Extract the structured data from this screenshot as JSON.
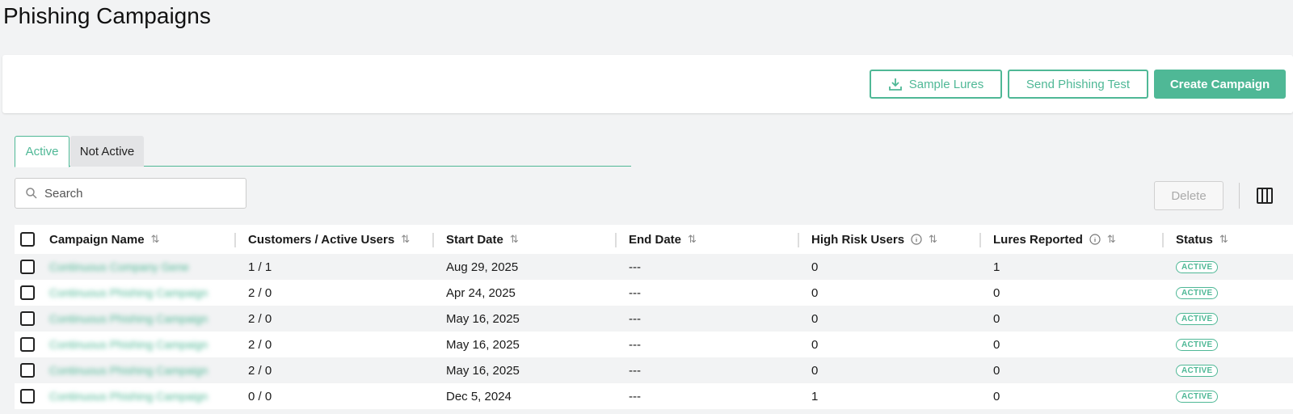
{
  "page": {
    "title": "Phishing Campaigns"
  },
  "toolbar": {
    "sample_lures_label": "Sample Lures",
    "send_test_label": "Send Phishing Test",
    "create_label": "Create Campaign"
  },
  "tabs": [
    {
      "label": "Active",
      "active": true
    },
    {
      "label": "Not Active",
      "active": false
    }
  ],
  "search": {
    "placeholder": "Search"
  },
  "actions": {
    "delete_label": "Delete"
  },
  "colors": {
    "accent": "#4fb896",
    "background": "#f2f3f4"
  },
  "table": {
    "columns": [
      "Campaign Name",
      "Customers / Active Users",
      "Start Date",
      "End Date",
      "High Risk Users",
      "Lures Reported",
      "Status"
    ],
    "rows": [
      {
        "name": "Continuous Company Gene",
        "users": "1 / 1",
        "start": "Aug 29, 2025",
        "end": "---",
        "high_risk": "0",
        "reported": "1",
        "status": "ACTIVE"
      },
      {
        "name": "Continuous Phishing Campaign",
        "users": "2 / 0",
        "start": "Apr 24, 2025",
        "end": "---",
        "high_risk": "0",
        "reported": "0",
        "status": "ACTIVE"
      },
      {
        "name": "Continuous Phishing Campaign",
        "users": "2 / 0",
        "start": "May 16, 2025",
        "end": "---",
        "high_risk": "0",
        "reported": "0",
        "status": "ACTIVE"
      },
      {
        "name": "Continuous Phishing Campaign",
        "users": "2 / 0",
        "start": "May 16, 2025",
        "end": "---",
        "high_risk": "0",
        "reported": "0",
        "status": "ACTIVE"
      },
      {
        "name": "Continuous Phishing Campaign",
        "users": "2 / 0",
        "start": "May 16, 2025",
        "end": "---",
        "high_risk": "0",
        "reported": "0",
        "status": "ACTIVE"
      },
      {
        "name": "Continuous Phishing Campaign",
        "users": "0 / 0",
        "start": "Dec 5, 2024",
        "end": "---",
        "high_risk": "1",
        "reported": "0",
        "status": "ACTIVE"
      }
    ]
  }
}
